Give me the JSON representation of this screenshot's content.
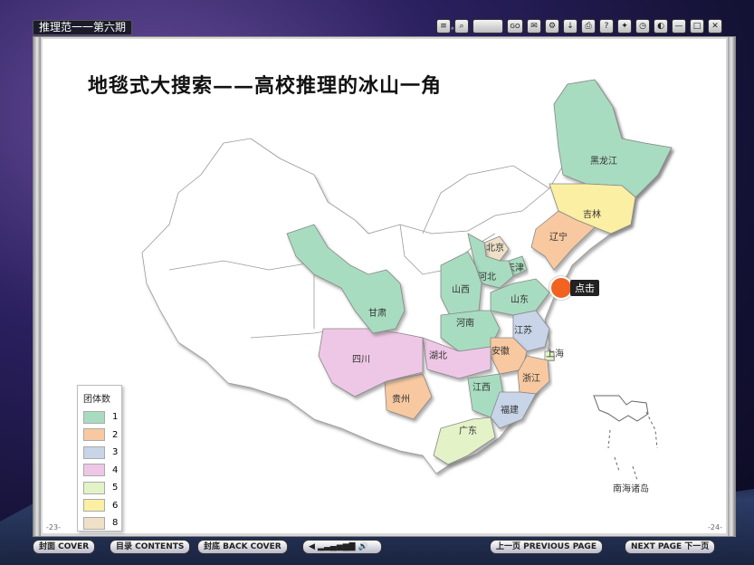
{
  "window": {
    "title": "推理范一一第六期"
  },
  "toolbar": {
    "go_label": "GO",
    "icons": [
      "toc-icon",
      "zoom-icon",
      "zoom-field",
      "go-button",
      "comment-icon",
      "share-icon",
      "download-icon",
      "print-icon",
      "help-icon",
      "settings-icon",
      "clock-icon",
      "sound-icon",
      "minimize-icon",
      "maximize-icon",
      "close-icon"
    ]
  },
  "page": {
    "heading": "地毯式大搜索——高校推理的冰山一角",
    "left_page_number": "-23-",
    "right_page_number": "-24-"
  },
  "map": {
    "provinces": [
      {
        "name": "黑龙江",
        "group": "1"
      },
      {
        "name": "吉林",
        "group": "6"
      },
      {
        "name": "辽宁",
        "group": "2"
      },
      {
        "name": "北京",
        "group": "8"
      },
      {
        "name": "天津",
        "group": "1"
      },
      {
        "name": "河北",
        "group": "1"
      },
      {
        "name": "山西",
        "group": "1"
      },
      {
        "name": "山东",
        "group": "1"
      },
      {
        "name": "河南",
        "group": "1"
      },
      {
        "name": "江苏",
        "group": "3"
      },
      {
        "name": "上海",
        "group": "5"
      },
      {
        "name": "安徽",
        "group": "2"
      },
      {
        "name": "浙江",
        "group": "2"
      },
      {
        "name": "湖北",
        "group": "4"
      },
      {
        "name": "江西",
        "group": "1"
      },
      {
        "name": "福建",
        "group": "3"
      },
      {
        "name": "广东",
        "group": "5"
      },
      {
        "name": "贵州",
        "group": "2"
      },
      {
        "name": "四川",
        "group": "4"
      },
      {
        "name": "甘肃",
        "group": "1"
      }
    ],
    "click_label": "点击",
    "south_sea_label": "南海诸岛"
  },
  "legend": {
    "title": "团体数",
    "items": [
      {
        "label": "1",
        "color": "#a8dcc0"
      },
      {
        "label": "2",
        "color": "#f8c9a0"
      },
      {
        "label": "3",
        "color": "#c8d4e8"
      },
      {
        "label": "4",
        "color": "#efc7e6"
      },
      {
        "label": "5",
        "color": "#e4f2c8"
      },
      {
        "label": "6",
        "color": "#fbefa3"
      },
      {
        "label": "8",
        "color": "#efe0c8"
      }
    ]
  },
  "bottombar": {
    "cover": "封面 COVER",
    "contents": "目录 CONTENTS",
    "back_cover": "封底 BACK COVER",
    "prev": "上一页 PREVIOUS PAGE",
    "next": "NEXT PAGE 下一页"
  }
}
